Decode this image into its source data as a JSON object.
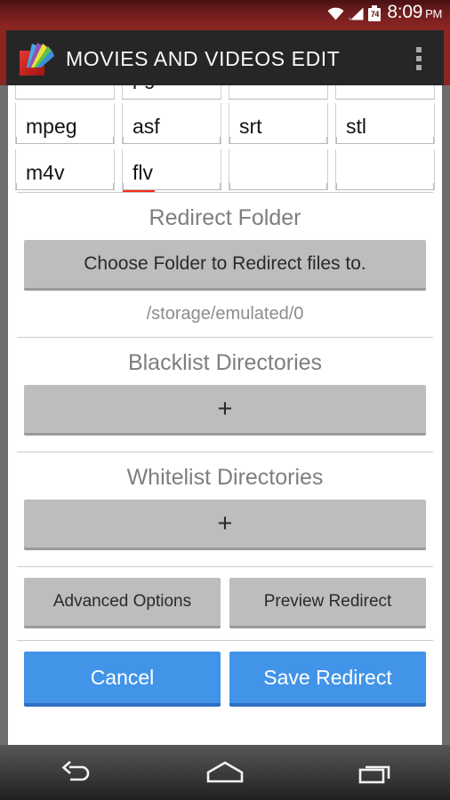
{
  "statusbar": {
    "time": "8:09",
    "ampm": "PM",
    "battery_level": "74",
    "icons": [
      "wifi-icon",
      "signal-icon",
      "battery-icon"
    ]
  },
  "actionbar": {
    "title": "MOVIES AND VIDEOS EDIT",
    "app_icon": "movies-videos-app-icon",
    "overflow_icon": "overflow-menu-icon"
  },
  "extensions": {
    "clipped_row": [
      "",
      "pg",
      "",
      ""
    ],
    "rows": [
      [
        "mpeg",
        "asf",
        "srt",
        "stl"
      ],
      [
        "m4v",
        "flv",
        "",
        ""
      ]
    ],
    "error_cells": [
      "flv"
    ]
  },
  "redirect_folder": {
    "title": "Redirect Folder",
    "choose_button": "Choose Folder to Redirect files to.",
    "path": "/storage/emulated/0"
  },
  "blacklist": {
    "title": "Blacklist Directories",
    "add_button": "+"
  },
  "whitelist": {
    "title": "Whitelist Directories",
    "add_button": "+"
  },
  "options": {
    "advanced": "Advanced Options",
    "preview": "Preview Redirect"
  },
  "actions": {
    "cancel": "Cancel",
    "save": "Save Redirect"
  },
  "navbar": {
    "back": "back-icon",
    "home": "home-icon",
    "recents": "recents-icon"
  },
  "colors": {
    "accent_blue": "#4294e8",
    "accent_blue_dark": "#2f6fc4",
    "brand_red": "#8b2522",
    "actionbar_dark": "#262626",
    "button_gray": "#bdbdbd",
    "error_red": "#fb2c1b"
  }
}
